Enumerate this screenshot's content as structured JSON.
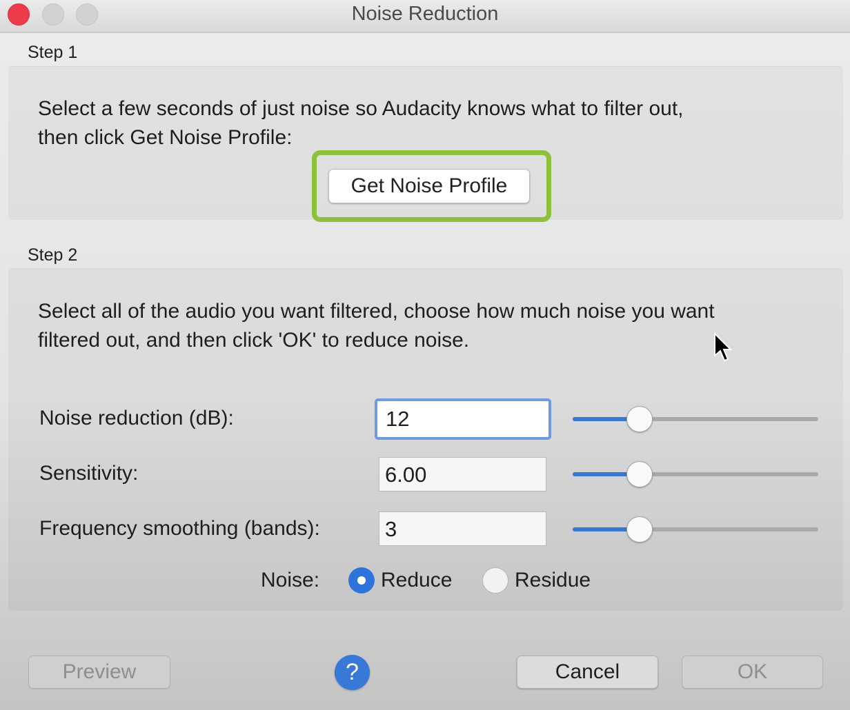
{
  "window": {
    "title": "Noise Reduction",
    "controls": [
      "close",
      "minimize",
      "maximize"
    ]
  },
  "step1": {
    "label": "Step 1",
    "instructions_line1": "Select a few seconds of just noise so Audacity knows what to filter out,",
    "instructions_line2": "then click Get Noise Profile:",
    "button_label": "Get Noise Profile",
    "highlight_color": "#8dc03b"
  },
  "step2": {
    "label": "Step 2",
    "instructions_line1": "Select all of the audio you want filtered, choose how much noise you want",
    "instructions_line2": "filtered out, and then click 'OK' to reduce noise.",
    "params": [
      {
        "label": "Noise reduction (dB):",
        "value": "12",
        "slider_fraction": 0.27
      },
      {
        "label": "Sensitivity:",
        "value": "6.00",
        "slider_fraction": 0.27
      },
      {
        "label": "Frequency smoothing (bands):",
        "value": "3",
        "slider_fraction": 0.27
      }
    ],
    "noise": {
      "label": "Noise:",
      "options": [
        {
          "label": "Reduce",
          "selected": true
        },
        {
          "label": "Residue",
          "selected": false
        }
      ]
    }
  },
  "footer": {
    "preview_label": "Preview",
    "help_symbol": "?",
    "cancel_label": "Cancel",
    "ok_label": "OK"
  },
  "colors": {
    "accent": "#3877d6",
    "close_button": "#ee3b4a",
    "focus_ring": "#6c9be0"
  }
}
